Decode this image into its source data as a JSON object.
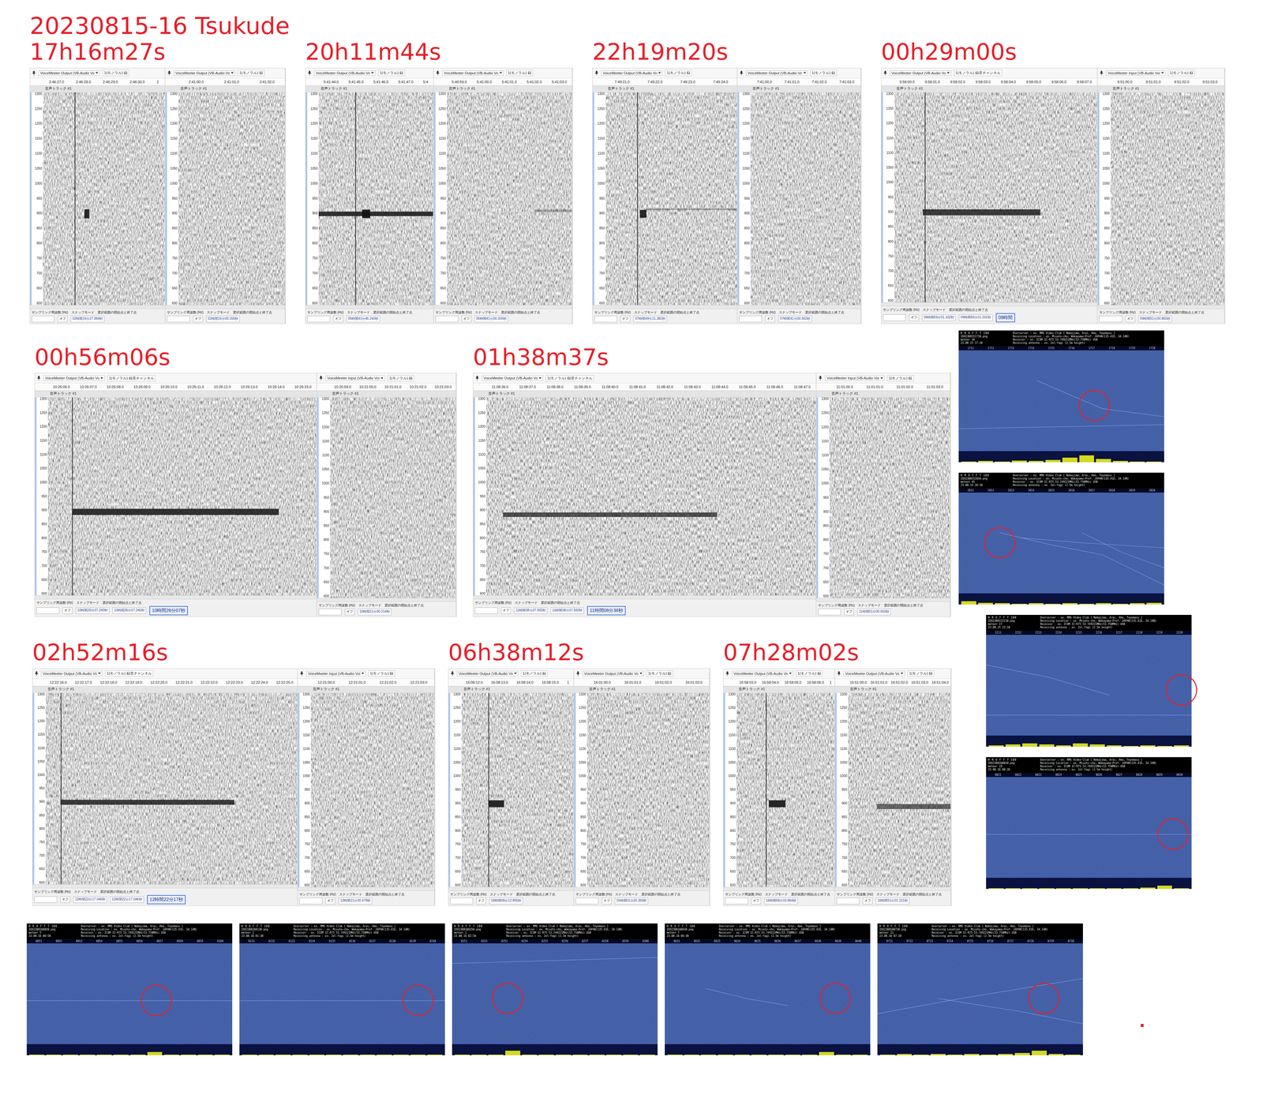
{
  "title": "20230815-16  Tsukude",
  "spectrogram": {
    "track": "音声トラック #1",
    "y_ticks": [
      "1300",
      "1250",
      "1200",
      "1150",
      "1100",
      "1050",
      "1000",
      "950",
      "900",
      "850",
      "800",
      "750",
      "700",
      "650",
      "600"
    ],
    "rate_label": "サンプリング周波数 (Hz)",
    "snap_label": "スナップモード",
    "range_label": "選択範囲の開始点と終了点",
    "snap_value": "オフ"
  },
  "panels": [
    {
      "label": "17h16m27s",
      "left": {
        "device": "VoiceMeeter Output (VB-Audio Vo",
        "channel": "1(モノラル) 録",
        "ticks": [
          "2:46:27.0",
          "2:46:28.0",
          "2:46:29.0",
          "2:46:30.0",
          "2"
        ],
        "cursor": 26,
        "echoes": [
          {
            "from": 34,
            "to": 38,
            "hz": 900,
            "thick": 30,
            "strength": 0.9
          }
        ],
        "fields": [
          "02時間16分27.994秒"
        ],
        "overlay": null
      },
      "right": {
        "device": "VoiceMeeter Output (VB-Audio Vo",
        "channel": "1(モノラル) 録",
        "ticks": [
          "2:41:00.0",
          "2:41:01.0",
          "2:41:02.0"
        ],
        "cursor": null,
        "echoes": [],
        "fields": [
          "02時間15分00.166秒"
        ],
        "overlay": null
      }
    },
    {
      "label": "20h11m44s",
      "left": {
        "device": "VoiceMeeter Output (VB-Audio Vo",
        "channel": "1(モノラル) 録",
        "ticks": [
          "5:41:44.0",
          "5:41:45.0",
          "5:41:46.0",
          "5:41:47.0",
          "5:4"
        ],
        "cursor": 32,
        "echoes": [
          {
            "from": 0,
            "to": 100,
            "hz": 900,
            "thick": 15,
            "strength": 0.85
          },
          {
            "from": 38,
            "to": 45,
            "hz": 900,
            "thick": 28,
            "strength": 0.95
          }
        ],
        "fields": [
          "05時間41分45.240秒"
        ],
        "overlay": null
      },
      "right": {
        "device": "VoiceMeeter Output (VB-Audio Vo",
        "channel": "1(モノラル) 録",
        "ticks": [
          "5:40:59.0",
          "5:41:00.0",
          "5:41:01.0",
          "5:41:02.0",
          "5:41:03.0"
        ],
        "cursor": null,
        "echoes": [
          {
            "from": 70,
            "to": 100,
            "hz": 910,
            "thick": 8,
            "strength": 0.3
          }
        ],
        "fields": [
          "05時間41分00.309秒"
        ],
        "overlay": null
      }
    },
    {
      "label": "22h19m20s",
      "left": {
        "device": "VoiceMeeter Output (VB-Audio Vo",
        "channel": "1(モノラル) 録",
        "ticks": [
          "7:49:21.0",
          "7:49:22.0",
          "7:49:23.0",
          "7:49:24.0"
        ],
        "cursor": 24,
        "echoes": [
          {
            "from": 26,
            "to": 31,
            "hz": 900,
            "thick": 26,
            "strength": 0.9
          },
          {
            "from": 31,
            "to": 100,
            "hz": 915,
            "thick": 6,
            "strength": 0.3
          }
        ],
        "fields": [
          "07時間49分21.382秒"
        ],
        "overlay": null
      },
      "right": {
        "device": "VoiceMeeter Output (VB-Audio Vo",
        "channel": "1(モノラル) 録",
        "ticks": [
          "7:41:00.0",
          "7:41:01.0",
          "7:41:02.0",
          "7:41:03.0"
        ],
        "cursor": null,
        "echoes": [],
        "fields": [
          "07時間41分00.562秒"
        ],
        "overlay": null
      }
    },
    {
      "label": "00h29m00s",
      "left": {
        "device": "VoiceMeeter Output (VB-Audio Vo",
        "channel": "1(モノラル) 録音チャンネル",
        "ticks": [
          "9:58:00.0",
          "9:58:01.0",
          "9:58:02.0",
          "9:58:03.0",
          "9:58:04.0",
          "9:58:05.0",
          "9:58:06.0",
          "9:58:07.0"
        ],
        "cursor": 15,
        "echoes": [
          {
            "from": 14,
            "to": 72,
            "hz": 900,
            "thick": 20,
            "strength": 0.8
          }
        ],
        "fields": [
          "09時間59分01.332秒",
          "09時間59分01.332秒"
        ],
        "overlay": "09時間"
      },
      "right": {
        "device": "VoiceMeeter Input (VB-Audio Voi",
        "channel": "1(モノラル) 録",
        "ticks": [
          "9:51:00.0",
          "9:51:01.0",
          "9:51:02.0",
          "9:51:03.0"
        ],
        "cursor": null,
        "echoes": [],
        "fields": [
          "09時間51分00.865秒"
        ],
        "overlay": null
      }
    },
    {
      "label": "00h56m06s",
      "left": {
        "device": "VoiceMeeter Output (VB-Audio Vo",
        "channel": "1(モノラル) 録音チャンネル",
        "ticks": [
          "10:26:06.0",
          "10:26:07.0",
          "10:26:08.0",
          "10:26:09.0",
          "10:26:10.0",
          "10:26:11.0",
          "10:26:12.0",
          "10:26:13.0",
          "10:26:14.0",
          "10:26:15.0"
        ],
        "cursor": 9,
        "echoes": [
          {
            "from": 9,
            "to": 86,
            "hz": 895,
            "thick": 22,
            "strength": 0.85
          }
        ],
        "fields": [
          "10時間26分07.240秒",
          "10時間26分07.240秒"
        ],
        "overlay": "10時間26分07秒"
      },
      "right": {
        "device": "VoiceMeeter Input (VB-Audio Voi",
        "channel": "1(モノラル) 録",
        "ticks": [
          "10:20:59.0",
          "10:21:00.0",
          "10:21:01.0",
          "10:21:02.0",
          "10:21:03.0"
        ],
        "cursor": null,
        "echoes": [],
        "fields": [
          "10時間21分00.214秒"
        ],
        "overlay": null
      }
    },
    {
      "label": "01h38m37s",
      "left": {
        "device": "VoiceMeeter Output (VB-Audio Vo",
        "channel": "1(モノラル) 録音チャンネル",
        "ticks": [
          "11:08:36.0",
          "11:08:37.0",
          "11:08:38.0",
          "11:08:39.0",
          "11:08:40.0",
          "11:08:41.0",
          "11:08:42.0",
          "11:08:43.0",
          "11:08:44.0",
          "11:08:45.0",
          "11:08:46.0",
          "11:08:47.0"
        ],
        "cursor": null,
        "echoes": [
          {
            "from": 5,
            "to": 70,
            "hz": 885,
            "thick": 16,
            "strength": 0.7
          }
        ],
        "fields": [
          "11時間08分37.592秒",
          "11時間08分37.592秒"
        ],
        "overlay": "11時間08分38秒"
      },
      "right": {
        "device": "VoiceMeeter Input (VB-Audio Voi",
        "channel": "1(モノラル) 録",
        "ticks": [
          "11:01:00.0",
          "11:01:01.0",
          "11:01:02.0",
          "11:01:03.0"
        ],
        "cursor": null,
        "echoes": [],
        "fields": [
          "11時間01分00.693秒"
        ],
        "overlay": null
      }
    },
    {
      "label": "02h52m16s",
      "left": {
        "device": "VoiceMeeter Output (VB-Audio Vo",
        "channel": "1(モノラル) 録音チャンネル",
        "ticks": [
          "12:22:16.0",
          "12:22:17.0",
          "12:22:18.0",
          "12:22:19.0",
          "12:22:20.0",
          "12:22:21.0",
          "12:22:22.0",
          "12:22:23.0",
          "12:22:24.0",
          "12:22:25.0"
        ],
        "cursor": 6,
        "echoes": [
          {
            "from": 6,
            "to": 75,
            "hz": 900,
            "thick": 18,
            "strength": 0.8
          }
        ],
        "fields": [
          "12時間22分17.046秒",
          "12時間22分17.046秒"
        ],
        "overlay": "12時間22分17秒"
      },
      "right": {
        "device": "VoiceMeeter Input (VB-Audio Voi",
        "channel": "1(モノラル) 録",
        "ticks": [
          "12:21:00.0",
          "12:21:01.0",
          "12:21:02.0",
          "12:21:03.0"
        ],
        "cursor": null,
        "echoes": [],
        "fields": [
          "12時間21分00.478秒"
        ],
        "overlay": null
      }
    },
    {
      "label": "06h38m12s",
      "left": {
        "device": "VoiceMeeter Output (VB-Audio Vo",
        "channel": "1(モノラル) 録",
        "ticks": [
          "16:08:12.0",
          "16:08:13.0",
          "16:08:14.0",
          "16:08:15.0",
          "1"
        ],
        "cursor": 24,
        "echoes": [
          {
            "from": 24,
            "to": 38,
            "hz": 900,
            "thick": 25,
            "strength": 0.9
          }
        ],
        "fields": [
          "16時間08分12.855秒"
        ],
        "overlay": null
      },
      "right": {
        "device": "VoiceMeeter Output (VB-Audio Vo",
        "channel": "1(モノラル) 録",
        "ticks": [
          "16:01:00.0",
          "16:01:01.0",
          "16:01:02.0",
          "16:01:03.0"
        ],
        "cursor": null,
        "echoes": [],
        "fields": [
          "16時間01分00.355秒"
        ],
        "overlay": null
      }
    },
    {
      "label": "07h28m02s",
      "left": {
        "device": "VoiceMeeter Output (VB-Audio Vo",
        "channel": "1(モノラル) 録",
        "ticks": [
          "16:58:03.0",
          "16:58:04.0",
          "16:58:05.0",
          "16:58:06.0",
          "1"
        ],
        "cursor": 30,
        "echoes": [
          {
            "from": 33,
            "to": 50,
            "hz": 900,
            "thick": 25,
            "strength": 0.9
          }
        ],
        "fields": [
          "16時間58分03.864秒"
        ],
        "overlay": null
      },
      "right": {
        "device": "VoiceMeeter Output (VB-Audio Vo",
        "channel": "1(モノラル) 録",
        "ticks": [
          "16:51:00.0",
          "16:51:01.0",
          "16:51:02.0",
          "16:51:03.0",
          "16:51:04.0"
        ],
        "cursor": null,
        "echoes": [
          {
            "from": 28,
            "to": 100,
            "hz": 890,
            "thick": 18,
            "strength": 0.6
          }
        ],
        "fields": [
          "16時間51分01.121秒"
        ],
        "overlay": null
      }
    }
  ],
  "hrofft_common": {
    "brand": "H R O F F T 100",
    "meteor_label": "meteor",
    "info": [
      "Overserver : ex. RMG Video Club [ Nakajima, Arai, Abe, Toyomasu ]",
      "Receiving Location : ex. Misato-cho, Wakayama-Pref. JAPAN(135.41E, 34.14N)",
      "Receiver : ex. ICOM IC-R75 53.749221MHz(53.750MHz) USB",
      "Receiving antenna : ex. 2el-Yagi (2.5m height)"
    ]
  },
  "hrofft": [
    {
      "file": "IOX2308151710.png",
      "count": "10",
      "date": "23.08.15 17:10",
      "ticks": [
        "1711",
        "1712",
        "1713",
        "1714",
        "1715",
        "1716",
        "1717",
        "1718",
        "1719",
        "1720"
      ],
      "mark": {
        "x": 66,
        "y": 55
      },
      "traces": [
        [
          38,
          30,
          55,
          45,
          70,
          58,
          100,
          66
        ],
        [
          0,
          78,
          50,
          76,
          100,
          74
        ]
      ],
      "spectrum": [
        0.05,
        0.1,
        0.05,
        0.15,
        0.1,
        0.2,
        0.4,
        0.6,
        0.3,
        0.1,
        0.05,
        0.05
      ]
    },
    {
      "file": "IOX2308152010.png",
      "count": "45",
      "date": "23.08.15 20:10",
      "ticks": [
        "2011",
        "2012",
        "2013",
        "2014",
        "2015",
        "2016",
        "2017",
        "2018",
        "2019",
        "2020"
      ],
      "mark": {
        "x": 20,
        "y": 50
      },
      "traces": [
        [
          20,
          40,
          45,
          52,
          70,
          62,
          100,
          92
        ],
        [
          30,
          45,
          60,
          50,
          100,
          55
        ],
        [
          60,
          40,
          80,
          60,
          100,
          75
        ]
      ],
      "spectrum": [
        0.3,
        0.15,
        0.1,
        0.05,
        0.1,
        0.05,
        0.1,
        0.05,
        0.1,
        0.05,
        0.1,
        0.15
      ]
    },
    {
      "file": "IOX2308152210.png",
      "count": "17",
      "date": "23.08.15 22:10",
      "ticks": [
        "2211",
        "2212",
        "2213",
        "2214",
        "2215",
        "2216",
        "2217",
        "2218",
        "2219",
        "2220"
      ],
      "mark": {
        "x": 95,
        "y": 55
      },
      "traces": [
        [
          0,
          30,
          30,
          42,
          60,
          60
        ],
        [
          0,
          80,
          100,
          80
        ]
      ],
      "spectrum": [
        0.1,
        0.2,
        0.3,
        0.2,
        0.1,
        0.3,
        0.2,
        0.1,
        0.05,
        0.1,
        0.05,
        0.1
      ]
    },
    {
      "file": "IOX2308160020.png",
      "count": "19",
      "date": "23.08.16 00:20",
      "ticks": [
        "0021",
        "0022",
        "0023",
        "0024",
        "0025",
        "0026",
        "0027",
        "0028",
        "0029",
        "0030"
      ],
      "mark": {
        "x": 91,
        "y": 57
      },
      "traces": [
        [
          0,
          57,
          100,
          57
        ]
      ],
      "spectrum": [
        0.05,
        0.05,
        0.05,
        0.05,
        0.05,
        0.05,
        0.05,
        0.05,
        0.05,
        0.1,
        0.3,
        0.05
      ]
    },
    {
      "file": "IOX2308160050.png",
      "count": "5",
      "date": "23.08.16 00:50",
      "ticks": [
        "0051",
        "0052",
        "0053",
        "0054",
        "0055",
        "0056",
        "0057",
        "0058",
        "0059",
        "0100"
      ],
      "mark": {
        "x": 63,
        "y": 57
      },
      "traces": [
        [
          0,
          57,
          100,
          57
        ]
      ],
      "spectrum": [
        0.05,
        0.05,
        0.05,
        0.05,
        0.05,
        0.05,
        0.05,
        0.3,
        0.05,
        0.05,
        0.05,
        0.05
      ]
    },
    {
      "file": "IOX2308160130.png",
      "count": "2",
      "date": "23.08.16 01:30",
      "ticks": [
        "0131",
        "0132",
        "0133",
        "0134",
        "0135",
        "0136",
        "0137",
        "0138",
        "0139",
        "0140"
      ],
      "mark": {
        "x": 87,
        "y": 57
      },
      "traces": [
        [
          0,
          57,
          100,
          57
        ]
      ],
      "spectrum": [
        0.05,
        0.05,
        0.05,
        0.05,
        0.05,
        0.05,
        0.05,
        0.05,
        0.05,
        0.05,
        0.05,
        0.05
      ]
    },
    {
      "file": "IOX2308160250.png",
      "count": "1",
      "date": "23.08.16 02:50",
      "ticks": [
        "0251",
        "0252",
        "0253",
        "0254",
        "0255",
        "0256",
        "0257",
        "0258",
        "0259",
        "0300"
      ],
      "mark": {
        "x": 27,
        "y": 55
      },
      "traces": [
        [
          0,
          20,
          100,
          14
        ]
      ],
      "spectrum": [
        0.05,
        0.05,
        0.05,
        0.4,
        0.05,
        0.05,
        0.05,
        0.05,
        0.05,
        0.05,
        0.05,
        0.05
      ]
    },
    {
      "file": "IOX2308160630.png",
      "count": "7",
      "date": "23.08.16 06:30",
      "ticks": [
        "0631",
        "0632",
        "0633",
        "0634",
        "0635",
        "0636",
        "0637",
        "0638",
        "0639",
        "0640"
      ],
      "mark": {
        "x": 83,
        "y": 55
      },
      "traces": [
        [
          20,
          45,
          40,
          55,
          60,
          62
        ]
      ],
      "spectrum": [
        0.05,
        0.05,
        0.05,
        0.05,
        0.05,
        0.05,
        0.05,
        0.05,
        0.05,
        0.3,
        0.05,
        0.05
      ]
    },
    {
      "file": "IOX2308160720.png",
      "count": "21",
      "date": "23.08.16 07:20",
      "ticks": [
        "0721",
        "0722",
        "0723",
        "0724",
        "0725",
        "0726",
        "0727",
        "0728",
        "0729",
        "0730"
      ],
      "mark": {
        "x": 81,
        "y": 55
      },
      "traces": [
        [
          0,
          70,
          40,
          55,
          70,
          45,
          100,
          35
        ],
        [
          30,
          55,
          70,
          68,
          100,
          80
        ]
      ],
      "spectrum": [
        0.05,
        0.1,
        0.05,
        0.1,
        0.05,
        0.1,
        0.05,
        0.1,
        0.2,
        0.4,
        0.1,
        0.05
      ]
    }
  ],
  "stray_dot": {
    "color": "#e0202a"
  }
}
